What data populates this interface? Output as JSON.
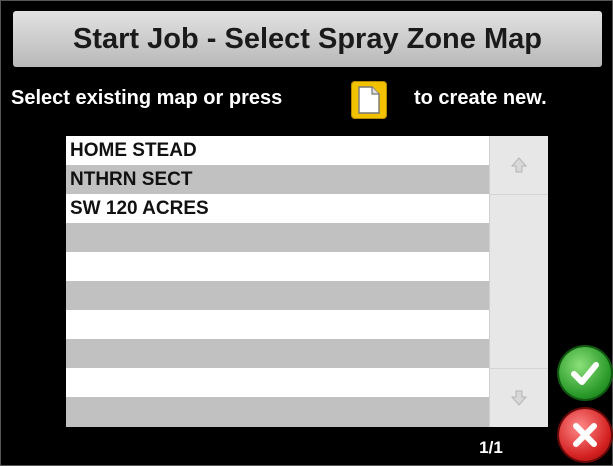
{
  "header": {
    "title": "Start Job - Select Spray Zone Map"
  },
  "instruction": {
    "before": "Select existing map or press",
    "after": "to create new."
  },
  "icons": {
    "new_map": "new-document-icon",
    "scroll_up": "arrow-up-icon",
    "scroll_down": "arrow-down-icon",
    "confirm": "checkmark-icon",
    "cancel": "close-icon"
  },
  "map_list": {
    "items": [
      "HOME STEAD",
      "NTHRN SECT",
      "SW 120 ACRES",
      "",
      "",
      "",
      "",
      "",
      "",
      ""
    ],
    "selected_index": null
  },
  "pagination": {
    "label": "1/1"
  },
  "colors": {
    "new_button": "#f2c100",
    "confirm": "#2a9a2a",
    "cancel": "#d42020",
    "row_alt": "#c1c1c1"
  }
}
